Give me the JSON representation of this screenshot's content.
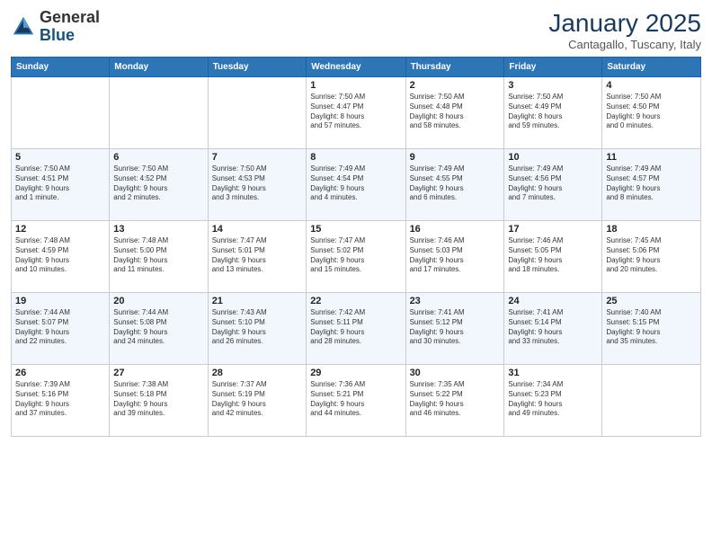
{
  "logo": {
    "general": "General",
    "blue": "Blue"
  },
  "header": {
    "month": "January 2025",
    "location": "Cantagallo, Tuscany, Italy"
  },
  "weekdays": [
    "Sunday",
    "Monday",
    "Tuesday",
    "Wednesday",
    "Thursday",
    "Friday",
    "Saturday"
  ],
  "weeks": [
    [
      {
        "day": "",
        "info": ""
      },
      {
        "day": "",
        "info": ""
      },
      {
        "day": "",
        "info": ""
      },
      {
        "day": "1",
        "info": "Sunrise: 7:50 AM\nSunset: 4:47 PM\nDaylight: 8 hours\nand 57 minutes."
      },
      {
        "day": "2",
        "info": "Sunrise: 7:50 AM\nSunset: 4:48 PM\nDaylight: 8 hours\nand 58 minutes."
      },
      {
        "day": "3",
        "info": "Sunrise: 7:50 AM\nSunset: 4:49 PM\nDaylight: 8 hours\nand 59 minutes."
      },
      {
        "day": "4",
        "info": "Sunrise: 7:50 AM\nSunset: 4:50 PM\nDaylight: 9 hours\nand 0 minutes."
      }
    ],
    [
      {
        "day": "5",
        "info": "Sunrise: 7:50 AM\nSunset: 4:51 PM\nDaylight: 9 hours\nand 1 minute."
      },
      {
        "day": "6",
        "info": "Sunrise: 7:50 AM\nSunset: 4:52 PM\nDaylight: 9 hours\nand 2 minutes."
      },
      {
        "day": "7",
        "info": "Sunrise: 7:50 AM\nSunset: 4:53 PM\nDaylight: 9 hours\nand 3 minutes."
      },
      {
        "day": "8",
        "info": "Sunrise: 7:49 AM\nSunset: 4:54 PM\nDaylight: 9 hours\nand 4 minutes."
      },
      {
        "day": "9",
        "info": "Sunrise: 7:49 AM\nSunset: 4:55 PM\nDaylight: 9 hours\nand 6 minutes."
      },
      {
        "day": "10",
        "info": "Sunrise: 7:49 AM\nSunset: 4:56 PM\nDaylight: 9 hours\nand 7 minutes."
      },
      {
        "day": "11",
        "info": "Sunrise: 7:49 AM\nSunset: 4:57 PM\nDaylight: 9 hours\nand 8 minutes."
      }
    ],
    [
      {
        "day": "12",
        "info": "Sunrise: 7:48 AM\nSunset: 4:59 PM\nDaylight: 9 hours\nand 10 minutes."
      },
      {
        "day": "13",
        "info": "Sunrise: 7:48 AM\nSunset: 5:00 PM\nDaylight: 9 hours\nand 11 minutes."
      },
      {
        "day": "14",
        "info": "Sunrise: 7:47 AM\nSunset: 5:01 PM\nDaylight: 9 hours\nand 13 minutes."
      },
      {
        "day": "15",
        "info": "Sunrise: 7:47 AM\nSunset: 5:02 PM\nDaylight: 9 hours\nand 15 minutes."
      },
      {
        "day": "16",
        "info": "Sunrise: 7:46 AM\nSunset: 5:03 PM\nDaylight: 9 hours\nand 17 minutes."
      },
      {
        "day": "17",
        "info": "Sunrise: 7:46 AM\nSunset: 5:05 PM\nDaylight: 9 hours\nand 18 minutes."
      },
      {
        "day": "18",
        "info": "Sunrise: 7:45 AM\nSunset: 5:06 PM\nDaylight: 9 hours\nand 20 minutes."
      }
    ],
    [
      {
        "day": "19",
        "info": "Sunrise: 7:44 AM\nSunset: 5:07 PM\nDaylight: 9 hours\nand 22 minutes."
      },
      {
        "day": "20",
        "info": "Sunrise: 7:44 AM\nSunset: 5:08 PM\nDaylight: 9 hours\nand 24 minutes."
      },
      {
        "day": "21",
        "info": "Sunrise: 7:43 AM\nSunset: 5:10 PM\nDaylight: 9 hours\nand 26 minutes."
      },
      {
        "day": "22",
        "info": "Sunrise: 7:42 AM\nSunset: 5:11 PM\nDaylight: 9 hours\nand 28 minutes."
      },
      {
        "day": "23",
        "info": "Sunrise: 7:41 AM\nSunset: 5:12 PM\nDaylight: 9 hours\nand 30 minutes."
      },
      {
        "day": "24",
        "info": "Sunrise: 7:41 AM\nSunset: 5:14 PM\nDaylight: 9 hours\nand 33 minutes."
      },
      {
        "day": "25",
        "info": "Sunrise: 7:40 AM\nSunset: 5:15 PM\nDaylight: 9 hours\nand 35 minutes."
      }
    ],
    [
      {
        "day": "26",
        "info": "Sunrise: 7:39 AM\nSunset: 5:16 PM\nDaylight: 9 hours\nand 37 minutes."
      },
      {
        "day": "27",
        "info": "Sunrise: 7:38 AM\nSunset: 5:18 PM\nDaylight: 9 hours\nand 39 minutes."
      },
      {
        "day": "28",
        "info": "Sunrise: 7:37 AM\nSunset: 5:19 PM\nDaylight: 9 hours\nand 42 minutes."
      },
      {
        "day": "29",
        "info": "Sunrise: 7:36 AM\nSunset: 5:21 PM\nDaylight: 9 hours\nand 44 minutes."
      },
      {
        "day": "30",
        "info": "Sunrise: 7:35 AM\nSunset: 5:22 PM\nDaylight: 9 hours\nand 46 minutes."
      },
      {
        "day": "31",
        "info": "Sunrise: 7:34 AM\nSunset: 5:23 PM\nDaylight: 9 hours\nand 49 minutes."
      },
      {
        "day": "",
        "info": ""
      }
    ]
  ]
}
